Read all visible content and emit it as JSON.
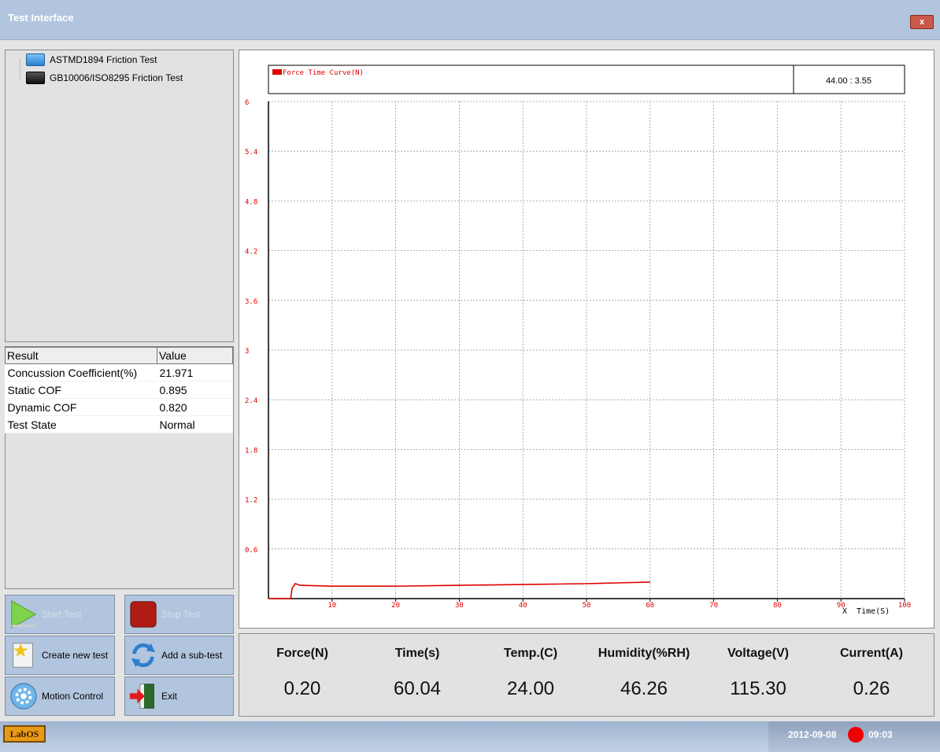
{
  "window": {
    "title": "Test Interface",
    "close_label": "x"
  },
  "tree": [
    {
      "label": "ASTMD1894 Friction Test"
    },
    {
      "label": "GB10006/ISO8295 Friction Test"
    }
  ],
  "results_table": {
    "headers": [
      "Result",
      "Value"
    ],
    "rows": [
      {
        "name": "Concussion Coefficient(%)",
        "value": "21.971"
      },
      {
        "name": "Static COF",
        "value": "0.895"
      },
      {
        "name": "Dynamic COF",
        "value": "0.820"
      },
      {
        "name": "Test State",
        "value": "Normal"
      }
    ]
  },
  "buttons": {
    "start_test": "Start Test",
    "stop_test": "Stop Test",
    "create_new_test": "Create new test",
    "add_sub_test": "Add a sub-test",
    "motion_control": "Motion Control",
    "exit": "Exit"
  },
  "chart_header": {
    "legend": "Force Time Curve(N)",
    "cursor_readout": "44.00 : 3.55"
  },
  "chart_data": {
    "type": "line",
    "xlabel": "X  Time(S)",
    "xlim": [
      0,
      100
    ],
    "ylim": [
      0,
      6
    ],
    "x_ticks": [
      "10",
      "20",
      "30",
      "40",
      "50",
      "60",
      "70",
      "80",
      "90",
      "100"
    ],
    "y_ticks": [
      "0.6",
      "1.2",
      "1.8",
      "2.4",
      "3",
      "3.6",
      "4.2",
      "4.8",
      "5.4",
      "6"
    ],
    "grid": true,
    "series": [
      {
        "name": "Force Time Curve(N)",
        "color": "#e00000",
        "x": [
          0,
          3.5,
          3.7,
          4.2,
          5,
          10,
          20,
          30,
          40,
          50,
          55,
          60
        ],
        "y": [
          0,
          0,
          0.12,
          0.18,
          0.16,
          0.15,
          0.15,
          0.16,
          0.17,
          0.18,
          0.19,
          0.2
        ]
      }
    ]
  },
  "readouts": [
    {
      "label": "Force(N)",
      "value": "0.20"
    },
    {
      "label": "Time(s)",
      "value": "60.04"
    },
    {
      "label": "Temp.(C)",
      "value": "24.00"
    },
    {
      "label": "Humidity(%RH)",
      "value": "46.26"
    },
    {
      "label": "Voltage(V)",
      "value": "115.30"
    },
    {
      "label": "Current(A)",
      "value": "0.26"
    }
  ],
  "taskbar": {
    "start_label": "LabOS",
    "date": "2012-09-08",
    "time": "09:03"
  },
  "colors": {
    "accent": "#b2c5de",
    "curve": "#e00000",
    "record_dot": "#ee0000"
  }
}
